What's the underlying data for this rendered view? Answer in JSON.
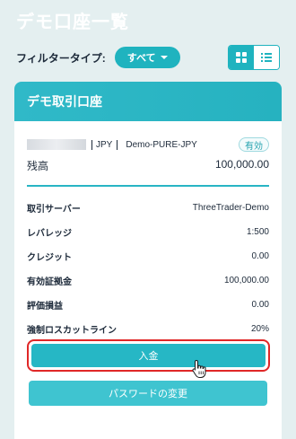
{
  "page": {
    "title": "デモ口座一覧"
  },
  "filter": {
    "label": "フィルタータイプ:",
    "selected": "すべて"
  },
  "view_toggle": {
    "grid_icon": "grid-icon",
    "list_icon": "list-icon"
  },
  "account_card": {
    "header": "デモ取引口座",
    "currency": "JPY",
    "group": "Demo-PURE-JPY",
    "status": "有効",
    "balance_label": "残高",
    "balance_value": "100,000.00",
    "details": [
      {
        "label": "取引サーバー",
        "value": "ThreeTrader-Demo"
      },
      {
        "label": "レバレッジ",
        "value": "1:500"
      },
      {
        "label": "クレジット",
        "value": "0.00"
      },
      {
        "label": "有効証拠金",
        "value": "100,000.00"
      },
      {
        "label": "評価損益",
        "value": "0.00"
      },
      {
        "label": "強制ロスカットライン",
        "value": "20%"
      }
    ],
    "deposit_button": "入金",
    "password_button": "パスワードの変更"
  },
  "colors": {
    "accent": "#1fb3bf",
    "highlight": "#e02727",
    "background": "#e4eff0"
  }
}
